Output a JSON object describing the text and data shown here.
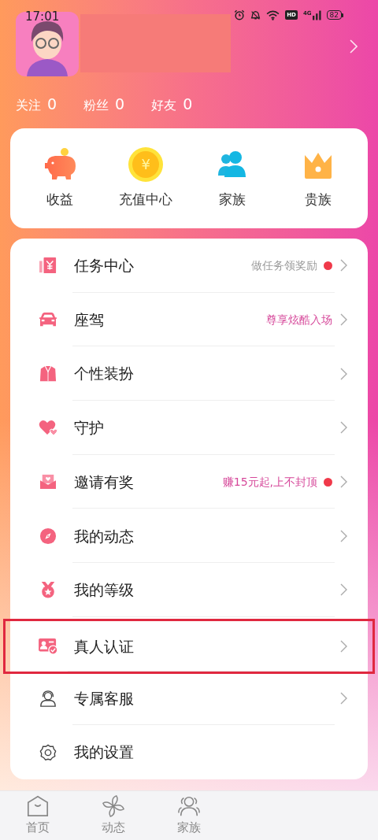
{
  "status_bar": {
    "time": "17:01",
    "hd": "HD",
    "network": "4G",
    "battery": "82"
  },
  "profile": {
    "stats": [
      {
        "label": "关注",
        "count": "0"
      },
      {
        "label": "粉丝",
        "count": "0"
      },
      {
        "label": "好友",
        "count": "0"
      }
    ]
  },
  "shortcuts": [
    {
      "kind": "piggy",
      "label": "收益"
    },
    {
      "kind": "coin",
      "label": "充值中心",
      "symbol": "¥"
    },
    {
      "kind": "people",
      "label": "家族"
    },
    {
      "kind": "crown",
      "label": "贵族"
    }
  ],
  "menu": [
    {
      "kind": "task",
      "label": "任务中心",
      "hint": {
        "text": "做任务领奖励",
        "color": "#9a9a9a"
      },
      "dot": true,
      "arrow": true,
      "highlighted": false
    },
    {
      "kind": "car",
      "label": "座驾",
      "hint": {
        "text": "尊享炫酷入场",
        "color": "#d6489a"
      },
      "dot": false,
      "arrow": true,
      "highlighted": false
    },
    {
      "kind": "suit",
      "label": "个性装扮",
      "dot": false,
      "arrow": true,
      "highlighted": false
    },
    {
      "kind": "heart",
      "label": "守护",
      "dot": false,
      "arrow": true,
      "highlighted": false
    },
    {
      "kind": "gift",
      "label": "邀请有奖",
      "hint": {
        "text": "赚15元起,上不封顶",
        "color": "#d6489a"
      },
      "dot": true,
      "arrow": true,
      "highlighted": false
    },
    {
      "kind": "compass",
      "label": "我的动态",
      "dot": false,
      "arrow": true,
      "highlighted": false
    },
    {
      "kind": "medal",
      "label": "我的等级",
      "dot": false,
      "arrow": true,
      "highlighted": false
    },
    {
      "kind": "idcard",
      "label": "真人认证",
      "dot": false,
      "arrow": true,
      "highlighted": true
    },
    {
      "kind": "headset",
      "label": "专属客服",
      "dot": false,
      "arrow": true,
      "highlighted": false
    },
    {
      "kind": "gear",
      "label": "我的设置",
      "dot": false,
      "arrow": false,
      "highlighted": false
    }
  ],
  "bottom_nav": [
    {
      "kind": "home",
      "label": "首页",
      "selected": false
    },
    {
      "kind": "pinwheel",
      "label": "动态",
      "selected": false
    },
    {
      "kind": "navpeople",
      "label": "家族",
      "selected": false
    }
  ]
}
